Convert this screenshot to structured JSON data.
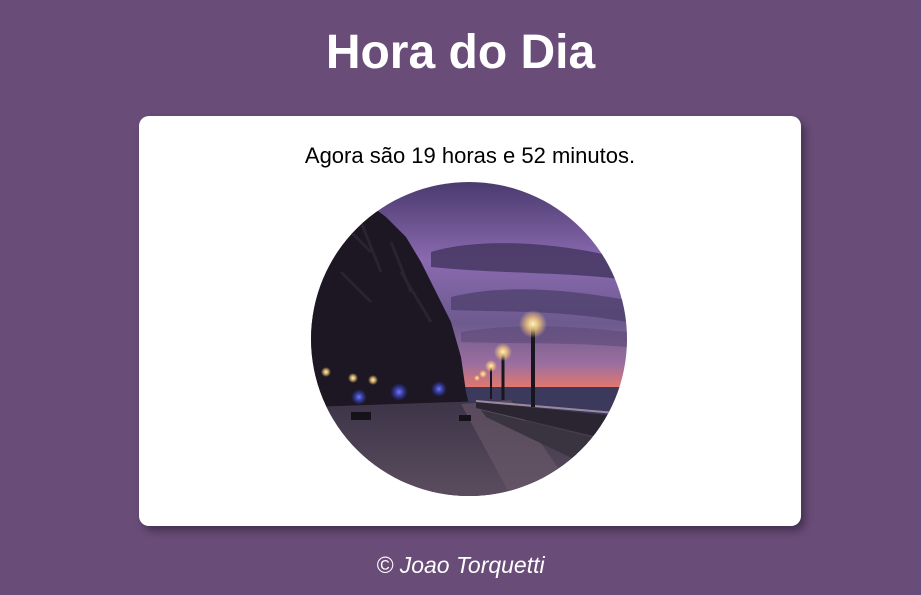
{
  "header": {
    "title": "Hora do Dia"
  },
  "main": {
    "message": "Agora são 19 horas e 52 minutos.",
    "image": {
      "subject": "evening-waterfront-promenade-photo"
    }
  },
  "footer": {
    "text": "© Joao Torquetti"
  },
  "colors": {
    "background": "#694c78",
    "card": "#ffffff",
    "text_light": "#ffffff",
    "text_dark": "#000000"
  }
}
